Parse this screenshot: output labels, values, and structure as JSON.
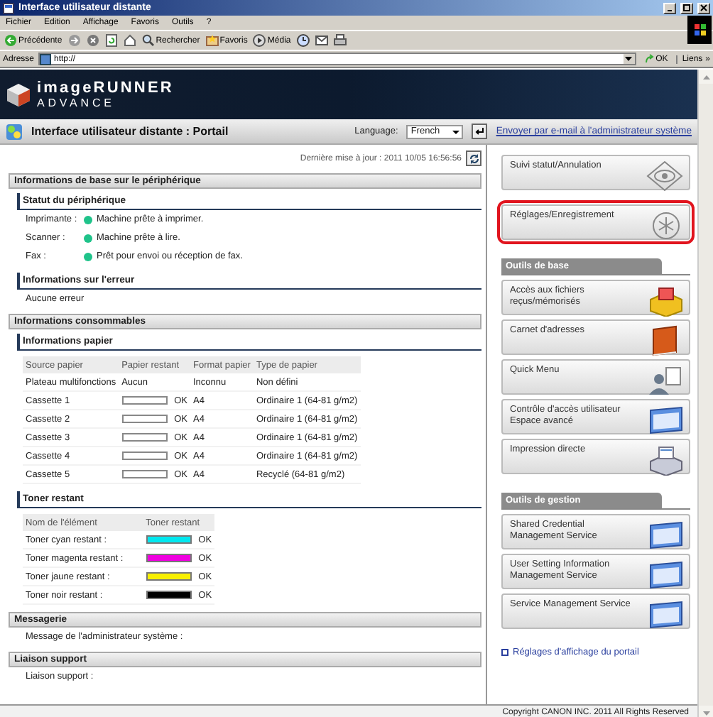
{
  "window": {
    "title": "Interface utilisateur distante"
  },
  "menu": [
    "Fichier",
    "Edition",
    "Affichage",
    "Favoris",
    "Outils",
    "?"
  ],
  "toolbar": [
    {
      "kind": "back",
      "label": "Précédente"
    },
    {
      "kind": "forward"
    },
    {
      "kind": "stop"
    },
    {
      "kind": "refresh"
    },
    {
      "kind": "home"
    },
    {
      "kind": "search",
      "label": "Rechercher"
    },
    {
      "kind": "favorites",
      "label": "Favoris"
    },
    {
      "kind": "media",
      "label": "Média"
    },
    {
      "kind": "history"
    },
    {
      "kind": "mail"
    },
    {
      "kind": "print"
    }
  ],
  "address": {
    "label": "Adresse",
    "value": "http://",
    "go": "OK",
    "links": "Liens",
    "more": "»"
  },
  "banner": {
    "line1": "imageRUNNER",
    "line2": "ADVANCE"
  },
  "portal": {
    "title": "Interface utilisateur distante : Portail",
    "language_label": "Language:",
    "language": "French",
    "mail_link": "Envoyer par e-mail à l'administrateur système"
  },
  "last_update": "Dernière mise à jour : 2011 10/05 16:56:56",
  "device": {
    "title": "Informations de base sur le périphérique",
    "status_title": "Statut du périphérique",
    "status": [
      {
        "label": "Imprimante :",
        "text": "Machine prête à imprimer.",
        "color": "#1fc38a"
      },
      {
        "label": "Scanner :",
        "text": "Machine prête à lire.",
        "color": "#1fc38a"
      },
      {
        "label": "Fax :",
        "text": "Prêt pour envoi ou réception de fax.",
        "color": "#1fc38a"
      }
    ],
    "error_title": "Informations sur l'erreur",
    "error_text": "Aucune erreur"
  },
  "consumables": {
    "title": "Informations consommables",
    "paper_title": "Informations papier",
    "paper_columns": [
      "Source papier",
      "Papier restant",
      "Format papier",
      "Type de papier"
    ],
    "paper_rows": [
      {
        "source": "Plateau multifonctions",
        "gauge": false,
        "remaining": "Aucun",
        "format": "Inconnu",
        "type": "Non défini"
      },
      {
        "source": "Cassette 1",
        "gauge": true,
        "remaining": "OK",
        "format": "A4",
        "type": "Ordinaire 1 (64-81 g/m2)"
      },
      {
        "source": "Cassette 2",
        "gauge": true,
        "remaining": "OK",
        "format": "A4",
        "type": "Ordinaire 1 (64-81 g/m2)"
      },
      {
        "source": "Cassette 3",
        "gauge": true,
        "remaining": "OK",
        "format": "A4",
        "type": "Ordinaire 1 (64-81 g/m2)"
      },
      {
        "source": "Cassette 4",
        "gauge": true,
        "remaining": "OK",
        "format": "A4",
        "type": "Ordinaire 1 (64-81 g/m2)"
      },
      {
        "source": "Cassette 5",
        "gauge": true,
        "remaining": "OK",
        "format": "A4",
        "type": "Recyclé (64-81 g/m2)"
      }
    ],
    "toner_title": "Toner restant",
    "toner_columns": [
      "Nom de l'élément",
      "Toner restant"
    ],
    "toner_rows": [
      {
        "name": "Toner cyan restant :",
        "color": "#00e8f0",
        "level": 1,
        "reading": "OK"
      },
      {
        "name": "Toner magenta restant :",
        "color": "#f000e0",
        "level": 1,
        "reading": "OK"
      },
      {
        "name": "Toner jaune restant :",
        "color": "#f8f000",
        "level": 1,
        "reading": "OK"
      },
      {
        "name": "Toner noir restant :",
        "color": "#000000",
        "level": 1,
        "reading": "OK"
      }
    ]
  },
  "messaging": {
    "title": "Messagerie",
    "text": "Message de l'administrateur système :"
  },
  "support": {
    "title": "Liaison support",
    "text": "Liaison support :"
  },
  "sidebar": {
    "top_buttons": [
      {
        "label": "Suivi statut/Annulation",
        "kind": "eye",
        "highlighted": false
      },
      {
        "label": "Réglages/Enregistrement",
        "kind": "gear",
        "highlighted": true
      }
    ],
    "groups": [
      {
        "title": "Outils de base",
        "buttons": [
          {
            "label": "Accès aux fichiers reçus/mémorisés",
            "kind": "filebox"
          },
          {
            "label": "Carnet d'adresses",
            "kind": "book"
          },
          {
            "label": "Quick Menu",
            "kind": "person"
          },
          {
            "label": "Contrôle d'accès utilisateur Espace avancé",
            "kind": "window"
          },
          {
            "label": "Impression directe",
            "kind": "printer"
          }
        ]
      },
      {
        "title": "Outils de gestion",
        "buttons": [
          {
            "label": "Shared Credential Management Service",
            "kind": "window"
          },
          {
            "label": "User Setting Information Management Service",
            "kind": "window"
          },
          {
            "label": "Service Management Service",
            "kind": "window"
          }
        ]
      }
    ],
    "link": "Réglages d'affichage du portail"
  },
  "status_bar": {
    "copyright": "Copyright CANON INC. 2011 All Rights Reserved"
  }
}
